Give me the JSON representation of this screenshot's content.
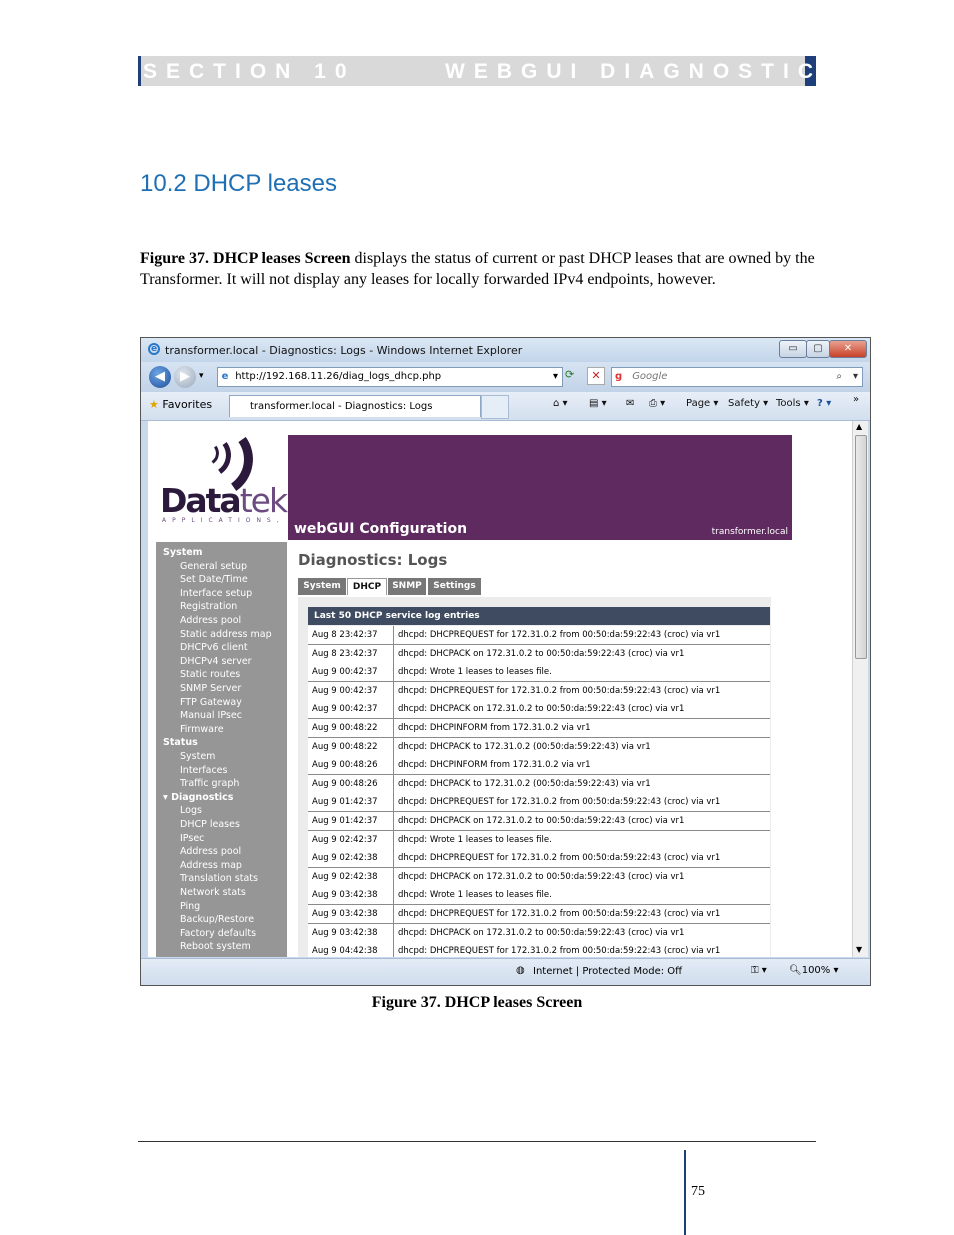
{
  "header": {
    "section": "SECTION 10",
    "title": "WEBGUI DIAGNOSTICS"
  },
  "heading": "10.2 DHCP leases",
  "intro": {
    "bold": "Figure 37. DHCP leases Screen",
    "text": " displays the status of current or past DHCP leases that are owned by the Transformer.   It will not display any leases for locally forwarded IPv4 endpoints, however."
  },
  "browser": {
    "title": "transformer.local - Diagnostics: Logs - Windows Internet Explorer",
    "url": "http://192.168.11.26/diag_logs_dhcp.php",
    "search_placeholder": "Google",
    "favorites_label": "Favorites",
    "tab_label": "transformer.local - Diagnostics: Logs",
    "cmd_page": "Page ▾",
    "cmd_safety": "Safety ▾",
    "cmd_tools": "Tools ▾",
    "status_zone": "Internet | Protected Mode: Off",
    "zoom": "100%",
    "win_minimize": "▭",
    "win_restore": "▢",
    "win_close": "✕"
  },
  "app": {
    "logo_main": "Data",
    "logo_accent": "tek",
    "logo_sub": "APPLICATIONS, INC",
    "banner_title": "webGUI Configuration",
    "banner_host": "transformer.local",
    "page_title": "Diagnostics: Logs",
    "tabs": [
      "System",
      "DHCP",
      "SNMP",
      "Settings"
    ],
    "sidebar": [
      {
        "label": "System",
        "section": true
      },
      {
        "label": "General setup"
      },
      {
        "label": "Set Date/Time"
      },
      {
        "label": "Interface setup"
      },
      {
        "label": "Registration"
      },
      {
        "label": "Address pool"
      },
      {
        "label": "Static address map"
      },
      {
        "label": "DHCPv6 client"
      },
      {
        "label": "DHCPv4 server"
      },
      {
        "label": "Static routes"
      },
      {
        "label": "SNMP Server"
      },
      {
        "label": "FTP Gateway"
      },
      {
        "label": "Manual IPsec"
      },
      {
        "label": "Firmware"
      },
      {
        "label": "Status",
        "section": true
      },
      {
        "label": "System"
      },
      {
        "label": "Interfaces"
      },
      {
        "label": "Traffic graph"
      },
      {
        "label": "▾ Diagnostics",
        "section": true
      },
      {
        "label": "Logs"
      },
      {
        "label": "DHCP leases"
      },
      {
        "label": "IPsec"
      },
      {
        "label": "Address pool"
      },
      {
        "label": "Address map"
      },
      {
        "label": "Translation stats"
      },
      {
        "label": "Network stats"
      },
      {
        "label": "Ping"
      },
      {
        "label": "Backup/Restore"
      },
      {
        "label": "Factory defaults"
      },
      {
        "label": "Reboot system"
      }
    ],
    "log_header": "Last 50 DHCP service log entries",
    "log_rows": [
      [
        "Aug 8 23:42:37",
        "dhcpd: DHCPREQUEST for 172.31.0.2 from 00:50:da:59:22:43 (croc) via vr1"
      ],
      [
        "Aug 8 23:42:37",
        "dhcpd: DHCPACK on 172.31.0.2 to 00:50:da:59:22:43 (croc) via vr1"
      ],
      [
        "Aug 9 00:42:37",
        "dhcpd: Wrote 1 leases to leases file."
      ],
      [
        "Aug 9 00:42:37",
        "dhcpd: DHCPREQUEST for 172.31.0.2 from 00:50:da:59:22:43 (croc) via vr1"
      ],
      [
        "Aug 9 00:42:37",
        "dhcpd: DHCPACK on 172.31.0.2 to 00:50:da:59:22:43 (croc) via vr1"
      ],
      [
        "Aug 9 00:48:22",
        "dhcpd: DHCPINFORM from 172.31.0.2 via vr1"
      ],
      [
        "Aug 9 00:48:22",
        "dhcpd: DHCPACK to 172.31.0.2 (00:50:da:59:22:43) via vr1"
      ],
      [
        "Aug 9 00:48:26",
        "dhcpd: DHCPINFORM from 172.31.0.2 via vr1"
      ],
      [
        "Aug 9 00:48:26",
        "dhcpd: DHCPACK to 172.31.0.2 (00:50:da:59:22:43) via vr1"
      ],
      [
        "Aug 9 01:42:37",
        "dhcpd: DHCPREQUEST for 172.31.0.2 from 00:50:da:59:22:43 (croc) via vr1"
      ],
      [
        "Aug 9 01:42:37",
        "dhcpd: DHCPACK on 172.31.0.2 to 00:50:da:59:22:43 (croc) via vr1"
      ],
      [
        "Aug 9 02:42:37",
        "dhcpd: Wrote 1 leases to leases file."
      ],
      [
        "Aug 9 02:42:38",
        "dhcpd: DHCPREQUEST for 172.31.0.2 from 00:50:da:59:22:43 (croc) via vr1"
      ],
      [
        "Aug 9 02:42:38",
        "dhcpd: DHCPACK on 172.31.0.2 to 00:50:da:59:22:43 (croc) via vr1"
      ],
      [
        "Aug 9 03:42:38",
        "dhcpd: Wrote 1 leases to leases file."
      ],
      [
        "Aug 9 03:42:38",
        "dhcpd: DHCPREQUEST for 172.31.0.2 from 00:50:da:59:22:43 (croc) via vr1"
      ],
      [
        "Aug 9 03:42:38",
        "dhcpd: DHCPACK on 172.31.0.2 to 00:50:da:59:22:43 (croc) via vr1"
      ],
      [
        "Aug 9 04:42:38",
        "dhcpd: DHCPREQUEST for 172.31.0.2 from 00:50:da:59:22:43 (croc) via vr1"
      ]
    ]
  },
  "caption": "Figure 37. DHCP leases Screen",
  "page_number": "75"
}
